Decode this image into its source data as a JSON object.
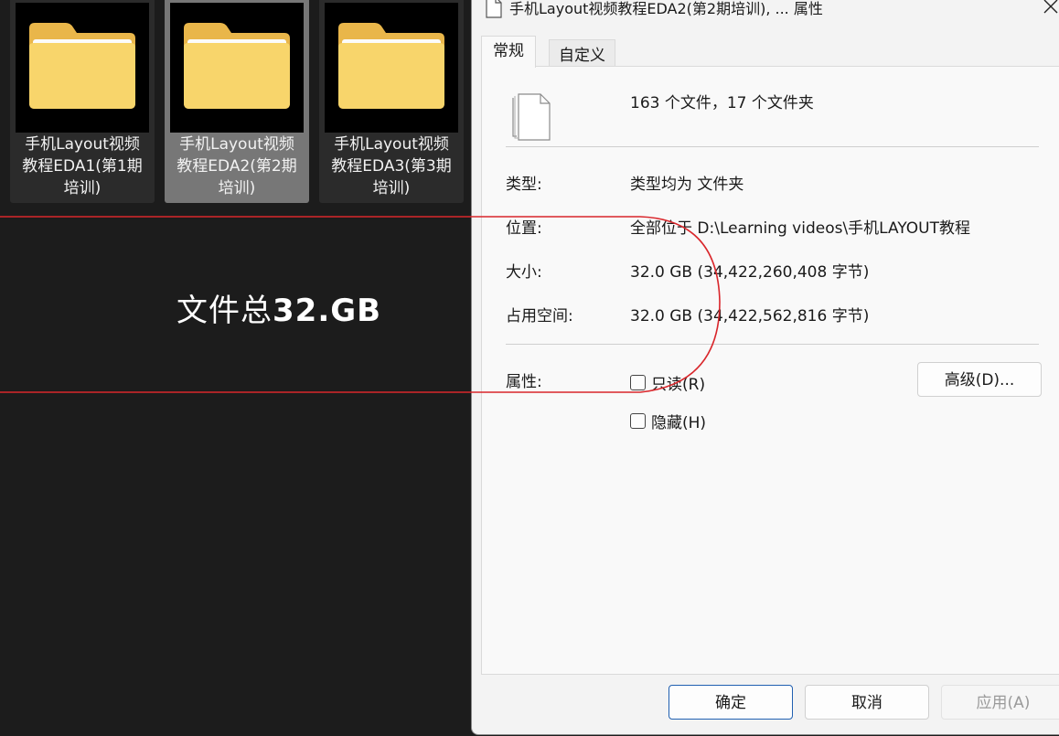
{
  "explorer": {
    "tiles": [
      {
        "label": "手机Layout视频\n教程EDA1(第1期\n培训)"
      },
      {
        "label": "手机Layout视频\n教程EDA2(第2期\n培训)"
      },
      {
        "label": "手机Layout视频\n教程EDA3(第3期\n培训)"
      }
    ],
    "caption_prefix": "文件总",
    "caption_size": "32.GB"
  },
  "dialog": {
    "title": "手机Layout视频教程EDA2(第2期培训), ... 属性",
    "close_icon": "close-icon",
    "tabs": [
      {
        "label": "常规",
        "active": true
      },
      {
        "label": "自定义",
        "active": false
      }
    ],
    "summary": "163 个文件，17 个文件夹",
    "props": {
      "type_label": "类型:",
      "type_value": "类型均为 文件夹",
      "location_label": "位置:",
      "location_value": "全部位于 D:\\Learning videos\\手机LAYOUT教程",
      "size_label": "大小:",
      "size_value": "32.0 GB (34,422,260,408 字节)",
      "disk_label": "占用空间:",
      "disk_value": "32.0 GB (34,422,562,816 字节)"
    },
    "attributes": {
      "label": "属性:",
      "readonly": "只读(R)",
      "readonly_checked": false,
      "hidden": "隐藏(H)",
      "hidden_checked": false,
      "advanced": "高级(D)..."
    },
    "buttons": {
      "ok": "确定",
      "cancel": "取消",
      "apply": "应用(A)"
    }
  },
  "colors": {
    "explorer_bg": "#1c1c1c",
    "dialog_bg": "#f3f3f3",
    "annotation_red": "#d9262b",
    "folder_yellow": "#f8d56b"
  }
}
